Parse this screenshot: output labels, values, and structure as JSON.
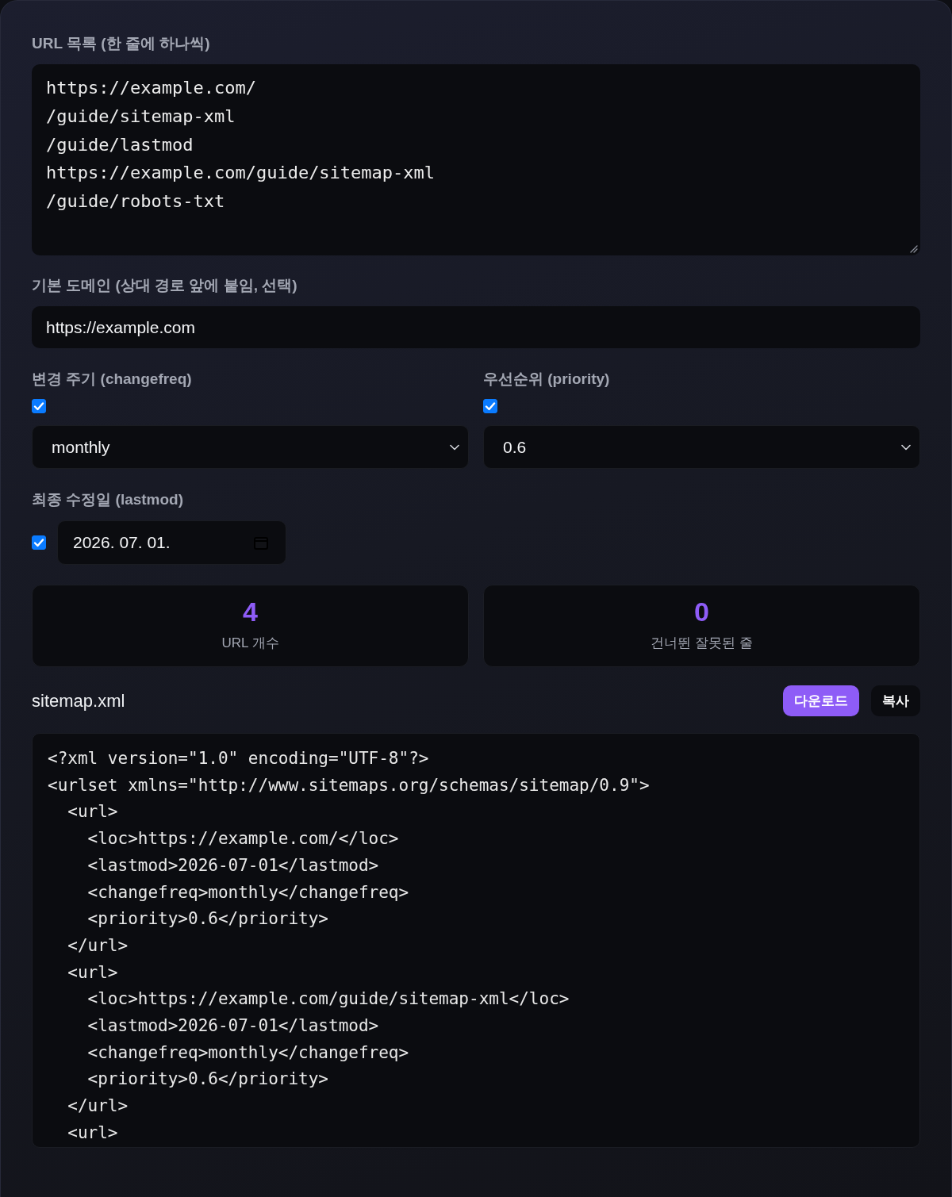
{
  "url_list": {
    "label": "URL 목록 (한 줄에 하나씩)",
    "lines": [
      "https://example.com/",
      "/guide/sitemap-xml",
      "/guide/lastmod",
      "https://example.com/guide/sitemap-xml",
      "/guide/robots-txt"
    ]
  },
  "base_domain": {
    "label": "기본 도메인 (상대 경로 앞에 붙임, 선택)",
    "value": "https://example.com"
  },
  "changefreq": {
    "label": "변경 주기 (changefreq)",
    "checked": true,
    "value": "monthly"
  },
  "priority": {
    "label": "우선순위 (priority)",
    "checked": true,
    "value": "0.6"
  },
  "lastmod": {
    "label": "최종 수정일 (lastmod)",
    "checked": true,
    "value": "2026. 07. 01."
  },
  "stats": [
    {
      "value": "4",
      "label": "URL 개수"
    },
    {
      "value": "0",
      "label": "건너뛴 잘못된 줄"
    }
  ],
  "output": {
    "title": "sitemap.xml",
    "buttons": [
      {
        "label": "다운로드",
        "kind": "primary"
      },
      {
        "label": "복사",
        "kind": "secondary"
      }
    ],
    "code_lines": [
      "<?xml version=\"1.0\" encoding=\"UTF-8\"?>",
      "<urlset xmlns=\"http://www.sitemaps.org/schemas/sitemap/0.9\">",
      "  <url>",
      "    <loc>https://example.com/</loc>",
      "    <lastmod>2026-07-01</lastmod>",
      "    <changefreq>monthly</changefreq>",
      "    <priority>0.6</priority>",
      "  </url>",
      "  <url>",
      "    <loc>https://example.com/guide/sitemap-xml</loc>",
      "    <lastmod>2026-07-01</lastmod>",
      "    <changefreq>monthly</changefreq>",
      "    <priority>0.6</priority>",
      "  </url>",
      "  <url>"
    ]
  }
}
